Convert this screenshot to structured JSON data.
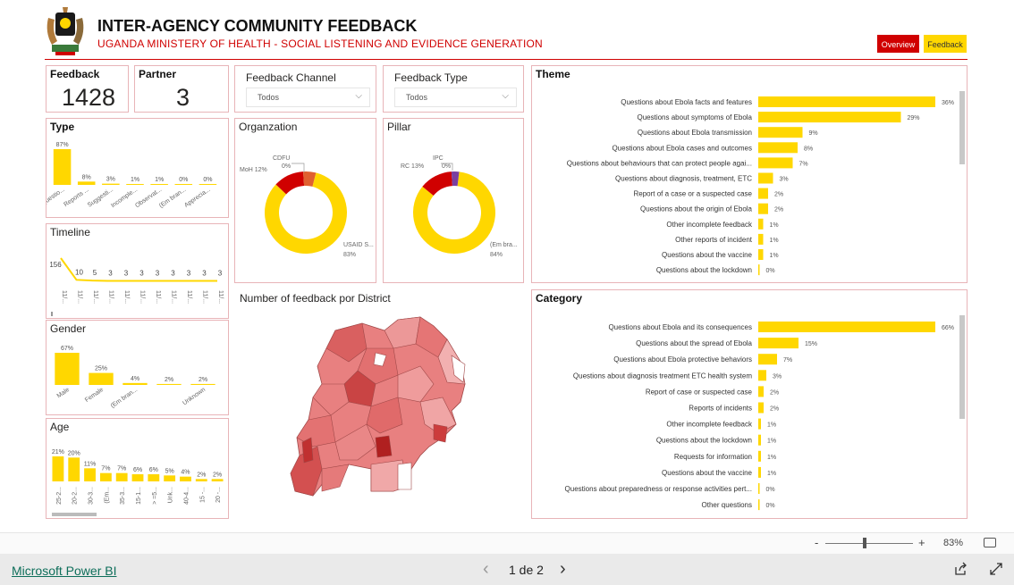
{
  "header": {
    "title": "INTER-AGENCY COMMUNITY FEEDBACK",
    "subtitle": "UGANDA MINISTERY OF HEALTH - SOCIAL LISTENING AND EVIDENCE GENERATION",
    "overview_label": "Overview",
    "feedback_label": "Feedback",
    "accent": "#d00000",
    "yellow": "#ffd700"
  },
  "kpis": {
    "feedback_label": "Feedback",
    "feedback_value": "1428",
    "partner_label": "Partner",
    "partner_value": "3"
  },
  "filters": {
    "channel_label": "Feedback Channel",
    "channel_value": "Todos",
    "type_label": "Feedback Type",
    "type_value": "Todos"
  },
  "type_chart": {
    "title": "Type",
    "bars": [
      {
        "label": "Questio...",
        "value": 87,
        "text": "87%"
      },
      {
        "label": "Reports ...",
        "value": 8,
        "text": "8%"
      },
      {
        "label": "Suggesti...",
        "value": 3,
        "text": "3%"
      },
      {
        "label": "Incomple...",
        "value": 1,
        "text": "1%"
      },
      {
        "label": "Observat...",
        "value": 1,
        "text": "1%"
      },
      {
        "label": "(Em bran...",
        "value": 0,
        "text": "0%"
      },
      {
        "label": "Apprecia...",
        "value": 0,
        "text": "0%"
      }
    ]
  },
  "timeline_chart": {
    "title": "Timeline",
    "values": [
      156,
      10,
      5,
      3,
      3,
      3,
      3,
      3,
      3,
      3,
      3
    ],
    "labels": [
      "11/...",
      "11/...",
      "11/...",
      "11/...",
      "11/...",
      "11/...",
      "11/...",
      "11/...",
      "11/...",
      "11/...",
      "11/..."
    ]
  },
  "gender_chart": {
    "title": "Gender",
    "bars": [
      {
        "label": "Male",
        "value": 67,
        "text": "67%"
      },
      {
        "label": "Female",
        "value": 25,
        "text": "25%"
      },
      {
        "label": "(Em bran...",
        "value": 4,
        "text": "4%"
      },
      {
        "label": "",
        "value": 2,
        "text": "2%"
      },
      {
        "label": "Unknown",
        "value": 2,
        "text": "2%"
      }
    ]
  },
  "age_chart": {
    "title": "Age",
    "bars": [
      {
        "label": "25-2...",
        "value": 21,
        "text": "21%"
      },
      {
        "label": "20-2...",
        "value": 20,
        "text": "20%"
      },
      {
        "label": "30-3...",
        "value": 11,
        "text": "11%"
      },
      {
        "label": "(Em...",
        "value": 7,
        "text": "7%"
      },
      {
        "label": "35-3...",
        "value": 7,
        "text": "7%"
      },
      {
        "label": "15-1...",
        "value": 6,
        "text": "6%"
      },
      {
        "label": "> =5...",
        "value": 6,
        "text": "6%"
      },
      {
        "label": "Unk...",
        "value": 5,
        "text": "5%"
      },
      {
        "label": "40-4...",
        "value": 4,
        "text": "4%"
      },
      {
        "label": "15 -...",
        "value": 2,
        "text": "2%"
      },
      {
        "label": "20 -...",
        "value": 2,
        "text": "2%"
      }
    ]
  },
  "organization_chart": {
    "title": "Organzation",
    "slices": [
      {
        "label": "USAID S...",
        "value": 83,
        "text": "83%",
        "color": "#ffd700"
      },
      {
        "label": "MoH",
        "value": 12,
        "text": "MoH 12%",
        "color": "#d00000"
      },
      {
        "label": "CDFU",
        "value": 5,
        "text": "CDFU",
        "color": "#e06030"
      }
    ],
    "zero_label": "0%"
  },
  "pillar_chart": {
    "title": "Pillar",
    "slices": [
      {
        "label": "(Em bra...",
        "value": 84,
        "text": "84%",
        "color": "#ffd700"
      },
      {
        "label": "RC",
        "value": 13,
        "text": "RC 13%",
        "color": "#d00000"
      },
      {
        "label": "IPC",
        "value": 3,
        "text": "IPC",
        "color": "#7a3fa0"
      }
    ],
    "zero_label": "0%"
  },
  "map": {
    "title": "Number of feedback por District"
  },
  "theme_chart": {
    "title": "Theme",
    "bars": [
      {
        "label": "Questions about Ebola facts and features",
        "value": 36,
        "text": "36%"
      },
      {
        "label": "Questions about symptoms of Ebola",
        "value": 29,
        "text": "29%"
      },
      {
        "label": "Questions about Ebola transmission",
        "value": 9,
        "text": "9%"
      },
      {
        "label": "Questions about Ebola cases and outcomes",
        "value": 8,
        "text": "8%"
      },
      {
        "label": "Questions about behaviours that can protect people agai...",
        "value": 7,
        "text": "7%"
      },
      {
        "label": "Questions about diagnosis, treatment, ETC",
        "value": 3,
        "text": "3%"
      },
      {
        "label": "Report of a case or a suspected case",
        "value": 2,
        "text": "2%"
      },
      {
        "label": "Questions about the origin of Ebola",
        "value": 2,
        "text": "2%"
      },
      {
        "label": "Other incomplete feedback",
        "value": 1,
        "text": "1%"
      },
      {
        "label": "Other reports of incident",
        "value": 1,
        "text": "1%"
      },
      {
        "label": "Questions about the vaccine",
        "value": 1,
        "text": "1%"
      },
      {
        "label": "Questions about the lockdown",
        "value": 0,
        "text": "0%"
      }
    ]
  },
  "category_chart": {
    "title": "Category",
    "bars": [
      {
        "label": "Questions about Ebola and its consequences",
        "value": 66,
        "text": "66%"
      },
      {
        "label": "Questions about the spread of Ebola",
        "value": 15,
        "text": "15%"
      },
      {
        "label": "Questions about Ebola protective behaviors",
        "value": 7,
        "text": "7%"
      },
      {
        "label": "Questions about diagnosis treatment ETC health system",
        "value": 3,
        "text": "3%"
      },
      {
        "label": "Report of case or suspected case",
        "value": 2,
        "text": "2%"
      },
      {
        "label": "Reports of incidents",
        "value": 2,
        "text": "2%"
      },
      {
        "label": "Other incomplete feedback",
        "value": 1,
        "text": "1%"
      },
      {
        "label": "Questions about the lockdown",
        "value": 1,
        "text": "1%"
      },
      {
        "label": "Requests for information",
        "value": 1,
        "text": "1%"
      },
      {
        "label": "Questions about the vaccine",
        "value": 1,
        "text": "1%"
      },
      {
        "label": "Questions about preparedness or response activities pert...",
        "value": 0,
        "text": "0%"
      },
      {
        "label": "Other questions",
        "value": 0,
        "text": "0%"
      }
    ]
  },
  "footer": {
    "zoom_minus": "-",
    "zoom_plus": "+",
    "zoom_level": "83%",
    "zoom_fraction": 0.45,
    "powerbi_link": "Microsoft Power BI",
    "page_indicator": "1 de 2",
    "prev": "‹",
    "next": "›"
  }
}
